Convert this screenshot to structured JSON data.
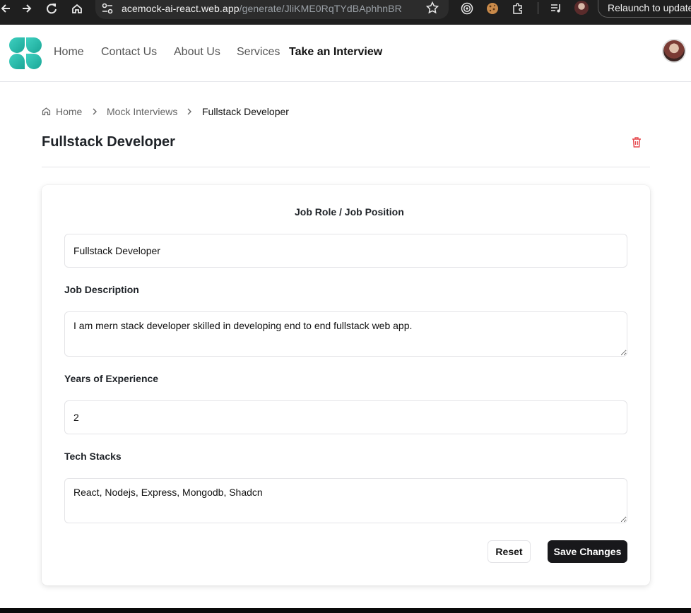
{
  "browser": {
    "url_host": "acemock-ai-react.web.app",
    "url_path": "/generate/JliKME0RqTYdBAphhnBR",
    "relaunch_label": "Relaunch to update",
    "icons": [
      "back-icon",
      "forward-icon",
      "reload-icon",
      "home-icon",
      "site-settings-icon",
      "bookmark-star-icon",
      "extension-target-icon",
      "cookie-icon",
      "extensions-puzzle-icon",
      "media-queue-icon",
      "profile-avatar"
    ]
  },
  "nav": {
    "items": [
      "Home",
      "Contact Us",
      "About Us",
      "Services",
      "Take an Interview"
    ],
    "active": "Take an Interview"
  },
  "breadcrumb": {
    "home": "Home",
    "parent": "Mock Interviews",
    "current": "Fullstack Developer"
  },
  "page": {
    "title": "Fullstack Developer"
  },
  "form": {
    "job_role_label": "Job Role / Job Position",
    "job_role_value": "Fullstack Developer",
    "job_description_label": "Job Description",
    "job_description_value": "I am mern stack developer skilled in developing end to end fullstack web app.",
    "experience_label": "Years of Experience",
    "experience_value": "2",
    "tech_stacks_label": "Tech Stacks",
    "tech_stacks_value": "React, Nodejs, Express, Mongodb, Shadcn",
    "reset_label": "Reset",
    "save_label": "Save Changes"
  },
  "colors": {
    "logo_teal": "#1fb8a8",
    "logo_teal_light": "#3fd1c1",
    "delete_red": "#e5484d",
    "primary_button": "#18181b"
  }
}
